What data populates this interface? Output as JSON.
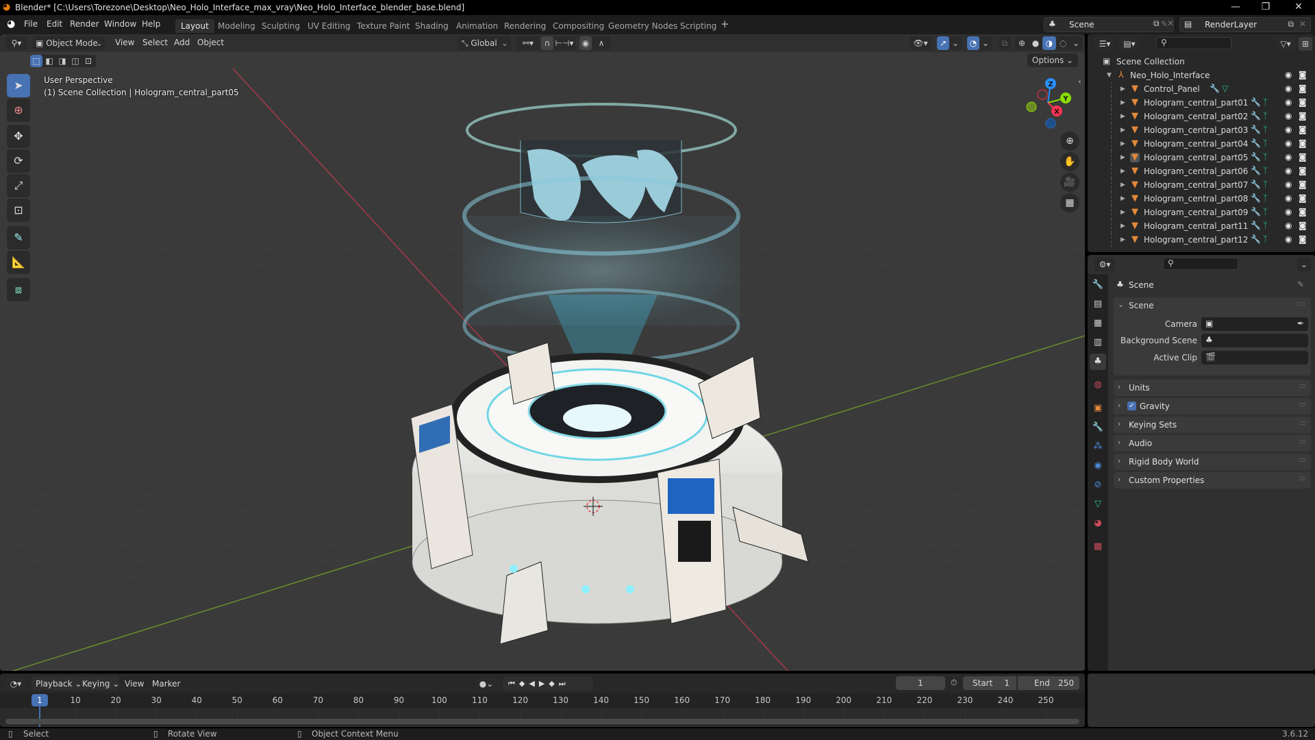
{
  "window": {
    "title": "Blender* [C:\\Users\\Torezone\\Desktop\\Neo_Holo_Interface_max_vray\\Neo_Holo_Interface_blender_base.blend]",
    "minimize_icon": "minimize-icon",
    "maximize_icon": "restore-icon",
    "close_icon": "close-icon"
  },
  "menubar": {
    "menus": [
      "File",
      "Edit",
      "Render",
      "Window",
      "Help"
    ],
    "workspaces": [
      "Layout",
      "Modeling",
      "Sculpting",
      "UV Editing",
      "Texture Paint",
      "Shading",
      "Animation",
      "Rendering",
      "Compositing",
      "Geometry Nodes",
      "Scripting"
    ],
    "active_workspace": "Layout",
    "add_workspace": "+",
    "scene_name": "Scene",
    "view_layer": "RenderLayer"
  },
  "viewport": {
    "mode": "Object Mode",
    "menus": [
      "View",
      "Select",
      "Add",
      "Object"
    ],
    "transform_orientation": "Global",
    "options_label": "Options",
    "overlay_line1": "User Perspective",
    "overlay_line2": "(1) Scene Collection | Hologram_central_part05",
    "gizmo_axes": {
      "x": "X",
      "y": "Y",
      "z": "Z"
    },
    "colors": {
      "x_axis": "#ff3352",
      "y_axis": "#8bdc00",
      "z_axis": "#2890ff",
      "accent": "#4772b3"
    },
    "tools": [
      "select-box",
      "cursor",
      "move",
      "rotate",
      "scale",
      "transform",
      "annotate",
      "measure",
      "add-cube"
    ]
  },
  "outliner": {
    "root": "Scene Collection",
    "collection": "Neo_Holo_Interface",
    "objects": [
      {
        "name": "Control_Panel",
        "modifier": true,
        "data": "mesh"
      },
      {
        "name": "Hologram_central_part01",
        "modifier": true,
        "data": "vertex-groups"
      },
      {
        "name": "Hologram_central_part02",
        "modifier": true,
        "data": "vertex-groups"
      },
      {
        "name": "Hologram_central_part03",
        "modifier": true,
        "data": "vertex-groups"
      },
      {
        "name": "Hologram_central_part04",
        "modifier": true,
        "data": "vertex-groups"
      },
      {
        "name": "Hologram_central_part05",
        "modifier": true,
        "data": "vertex-groups",
        "active": true
      },
      {
        "name": "Hologram_central_part06",
        "modifier": true,
        "data": "vertex-groups"
      },
      {
        "name": "Hologram_central_part07",
        "modifier": true,
        "data": "vertex-groups"
      },
      {
        "name": "Hologram_central_part08",
        "modifier": true,
        "data": "vertex-groups"
      },
      {
        "name": "Hologram_central_part09",
        "modifier": true,
        "data": "vertex-groups"
      },
      {
        "name": "Hologram_central_part11",
        "modifier": true,
        "data": "vertex-groups"
      },
      {
        "name": "Hologram_central_part12",
        "modifier": true,
        "data": "vertex-groups"
      }
    ]
  },
  "properties": {
    "context_title": "Scene",
    "scene_panel": {
      "title": "Scene",
      "fields": [
        {
          "label": "Camera",
          "value": ""
        },
        {
          "label": "Background Scene",
          "value": ""
        },
        {
          "label": "Active Clip",
          "value": ""
        }
      ]
    },
    "collapsed_panels": [
      "Units",
      "Gravity",
      "Keying Sets",
      "Audio",
      "Rigid Body World",
      "Custom Properties"
    ],
    "gravity_checked": true,
    "tabs": [
      "tool",
      "render",
      "output",
      "view-layer",
      "scene",
      "world",
      "object",
      "modifiers",
      "particles",
      "physics",
      "constraints",
      "data",
      "material",
      "texture"
    ],
    "active_tab": "scene"
  },
  "timeline": {
    "menus": [
      "Playback",
      "Keying",
      "View",
      "Marker"
    ],
    "current_frame": "1",
    "start_label": "Start",
    "start": "1",
    "end_label": "End",
    "end": "250",
    "ticks": [
      "10",
      "20",
      "30",
      "40",
      "50",
      "60",
      "70",
      "80",
      "90",
      "100",
      "110",
      "120",
      "130",
      "140",
      "150",
      "160",
      "170",
      "180",
      "190",
      "200",
      "210",
      "220",
      "230",
      "240",
      "250"
    ],
    "playhead": "1"
  },
  "statusbar": {
    "hints": [
      "Select",
      "Rotate View",
      "Object Context Menu"
    ],
    "version": "3.6.12"
  }
}
